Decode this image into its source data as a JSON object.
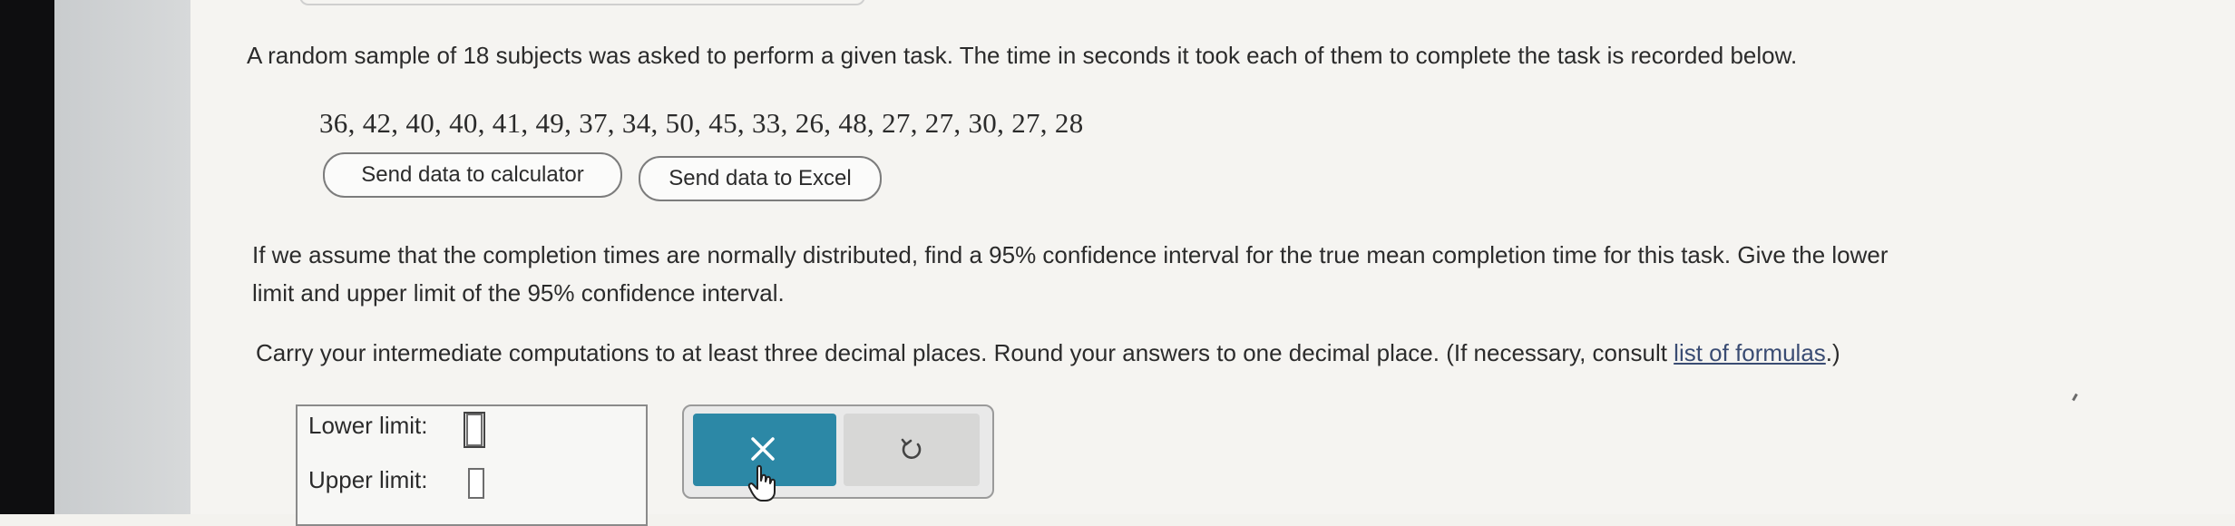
{
  "problem": {
    "intro": "A random sample of 18 subjects was asked to perform a given task. The time in seconds it took each of them to complete the task is recorded below.",
    "data_values": "36, 42, 40, 40, 41, 49, 37, 34, 50, 45, 33, 26, 48, 27, 27, 30, 27, 28",
    "question_line1": "If we assume that the completion times are normally distributed, find a 95% confidence interval for the true mean completion time for this task. Give the lower",
    "question_line2": "limit and upper limit of the 95% confidence interval.",
    "instructions_pre": "Carry your intermediate computations to at least three decimal places. Round your answers to one decimal place. (If necessary, consult ",
    "formulas_link": "list of formulas",
    "instructions_post": ".)"
  },
  "buttons": {
    "send_calculator": "Send data to calculator",
    "send_excel": "Send data to Excel"
  },
  "answers": {
    "lower_label": "Lower limit:",
    "upper_label": "Upper limit:",
    "lower_value": "",
    "upper_value": ""
  },
  "actions": {
    "clear_icon": "x-icon",
    "undo_icon": "undo-icon"
  },
  "colors": {
    "accent": "#2c88a6",
    "link": "#3a4c73"
  }
}
